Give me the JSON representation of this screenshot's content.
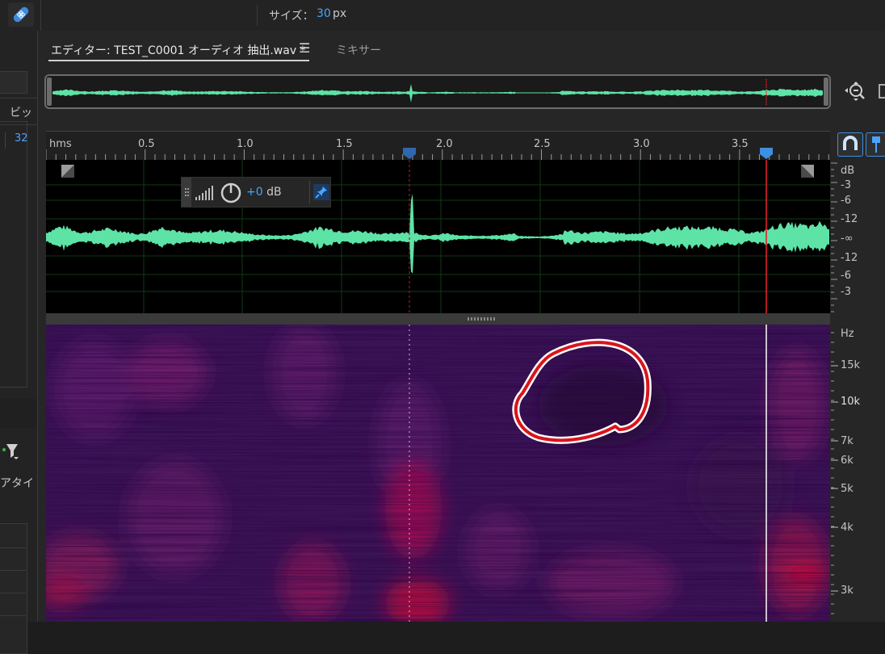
{
  "toolbar": {
    "size_label": "サイズ：",
    "size_value": "30",
    "size_unit": "px"
  },
  "left_panel": {
    "header_text": "ビッ",
    "value": "32",
    "column_text": "アタイ"
  },
  "editor": {
    "tab_editor": "エディター: TEST_C0001 オーディオ 抽出.wav *",
    "tab_menu": "☰",
    "tab_mixer": "ミキサー"
  },
  "ruler": {
    "unit": "hms",
    "labels": [
      "0.5",
      "1.0",
      "1.5",
      "2.0",
      "2.5",
      "3.0",
      "3.5"
    ]
  },
  "hud": {
    "gain_value": "+0",
    "gain_unit": "dB"
  },
  "db_scale": [
    "dB",
    "-3",
    "-6",
    "-12",
    "-∞",
    "-12",
    "-6",
    "-3"
  ],
  "hz_scale": [
    "Hz",
    "15k",
    "10k",
    "7k",
    "6k",
    "5k",
    "4k",
    "3k"
  ],
  "colors": {
    "waveform": "#5de3a6",
    "playhead": "#e0202a",
    "accent": "#4aa3ff",
    "selection_outline": "#d8151c"
  }
}
